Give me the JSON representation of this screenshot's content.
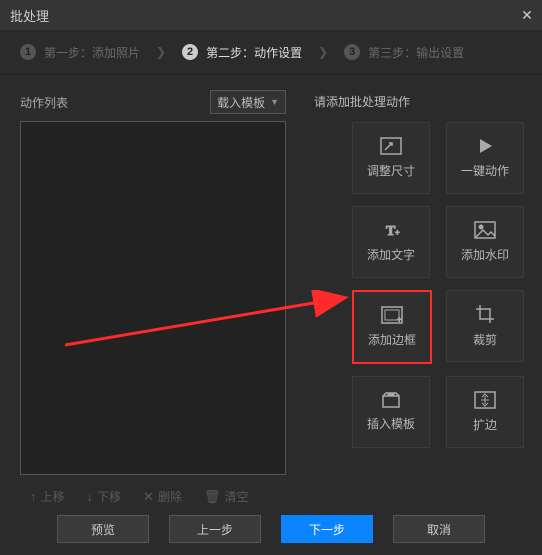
{
  "window": {
    "title": "批处理"
  },
  "steps": {
    "s1": {
      "num": "1",
      "label": "第一步：添加照片"
    },
    "s2": {
      "num": "2",
      "label": "第二步：动作设置"
    },
    "s3": {
      "num": "3",
      "label": "第三步：输出设置"
    }
  },
  "left": {
    "title": "动作列表",
    "template_btn": "载入模板",
    "toolbar": {
      "up": "上移",
      "down": "下移",
      "delete": "删除",
      "clear": "清空"
    }
  },
  "right": {
    "title": "请添加批处理动作",
    "tiles": {
      "resize": "调整尺寸",
      "oneclick": "一键动作",
      "text": "添加文字",
      "watermark": "添加水印",
      "border": "添加边框",
      "crop": "裁剪",
      "insert": "插入模板",
      "extend": "扩边"
    }
  },
  "footer": {
    "preview": "预览",
    "prev": "上一步",
    "next": "下一步",
    "cancel": "取消"
  }
}
